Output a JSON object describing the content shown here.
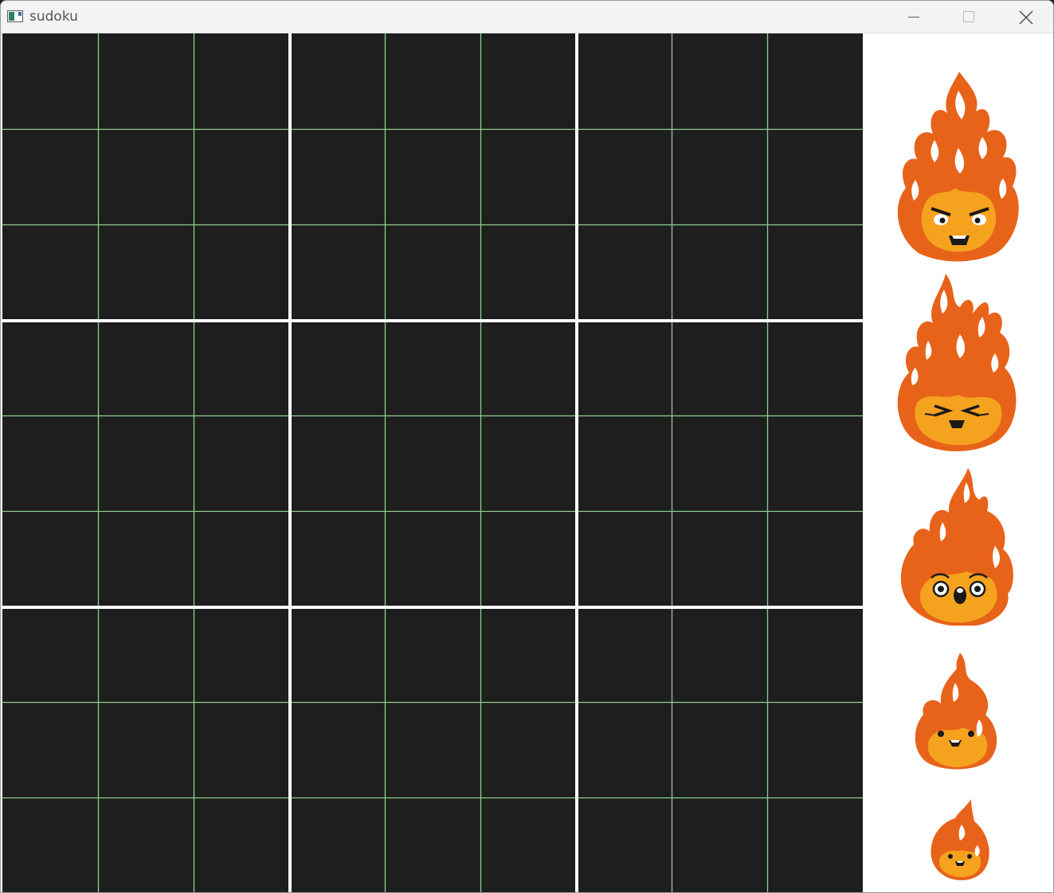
{
  "window": {
    "title": "sudoku",
    "icons": {
      "app": "app-window-icon",
      "minimize": "minimize-icon",
      "maximize": "maximize-icon",
      "close": "close-icon"
    }
  },
  "board": {
    "rows": 9,
    "cols": 9,
    "cells": [
      [
        "",
        "",
        "",
        "",
        "",
        "",
        "",
        "",
        ""
      ],
      [
        "",
        "",
        "",
        "",
        "",
        "",
        "",
        "",
        ""
      ],
      [
        "",
        "",
        "",
        "",
        "",
        "",
        "",
        "",
        ""
      ],
      [
        "",
        "",
        "",
        "",
        "",
        "",
        "",
        "",
        ""
      ],
      [
        "",
        "",
        "",
        "",
        "",
        "",
        "",
        "",
        ""
      ],
      [
        "",
        "",
        "",
        "",
        "",
        "",
        "",
        "",
        ""
      ],
      [
        "",
        "",
        "",
        "",
        "",
        "",
        "",
        "",
        ""
      ],
      [
        "",
        "",
        "",
        "",
        "",
        "",
        "",
        "",
        ""
      ],
      [
        "",
        "",
        "",
        "",
        "",
        "",
        "",
        "",
        ""
      ]
    ],
    "colors": {
      "background": "#1e1e1e",
      "thin_line": "#8fcf8f",
      "thick_line": "#ffffff"
    }
  },
  "sidebar": {
    "background": "#ffffff",
    "fires": [
      {
        "name": "angry-fire-icon",
        "mood": "angry"
      },
      {
        "name": "crying-fire-icon",
        "mood": "crying"
      },
      {
        "name": "shocked-fire-icon",
        "mood": "shocked"
      },
      {
        "name": "nervous-fire-icon",
        "mood": "nervous"
      },
      {
        "name": "small-fire-icon",
        "mood": "worried"
      }
    ],
    "colors": {
      "flame_outer": "#e8631a",
      "flame_inner": "#f5a21e",
      "flame_highlight": "#ffffff",
      "face": "#1a1a1a"
    }
  }
}
